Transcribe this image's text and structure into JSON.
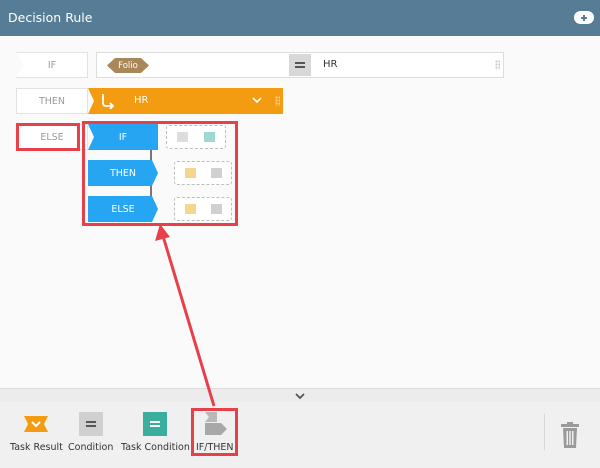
{
  "header": {
    "title": "Decision Rule",
    "add_icon": "plus-pill-icon"
  },
  "rule": {
    "if_label": "IF",
    "then_label": "THEN",
    "else_label": "ELSE",
    "condition": {
      "field": "Folio",
      "operator_icon": "equals-icon",
      "value": "HR"
    },
    "then_result": {
      "icon": "task-result-arrow-icon",
      "value": "HR",
      "expand_icon": "chevron-down-icon"
    }
  },
  "nested": {
    "if_label": "IF",
    "then_label": "THEN",
    "else_label": "ELSE"
  },
  "toolbox": {
    "collapse_icon": "chevron-down-icon",
    "items": [
      {
        "label": "Task Result",
        "icon": "task-result-icon",
        "color": "#f39c12"
      },
      {
        "label": "Condition",
        "icon": "condition-icon",
        "color": "#d0d0d0"
      },
      {
        "label": "Task Condition",
        "icon": "task-condition-icon",
        "color": "#3aaf9f"
      },
      {
        "label": "IF/THEN",
        "icon": "if-then-icon",
        "color": "#b0b0b0"
      }
    ],
    "delete_icon": "trash-icon"
  },
  "colors": {
    "header": "#567d95",
    "then_block": "#f39c12",
    "nested_block": "#26a6f2",
    "folio_tag": "#a88758",
    "annotation": "#e8404b"
  }
}
